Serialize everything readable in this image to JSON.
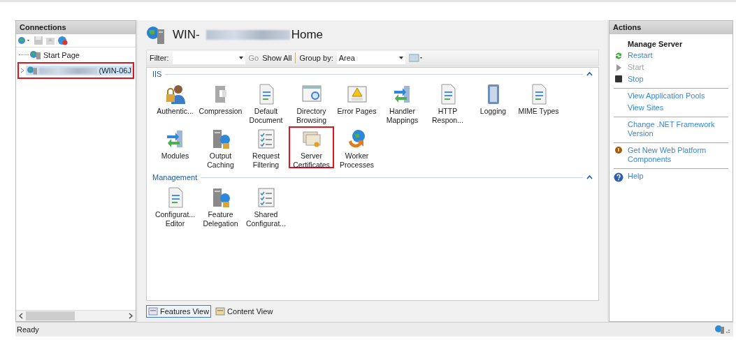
{
  "connections": {
    "title": "Connections",
    "tree": [
      {
        "label": "Start Page",
        "redacted": false,
        "selected": false,
        "highlighted": false
      },
      {
        "label": "(WIN-06J",
        "redacted": true,
        "selected": true,
        "highlighted": true
      }
    ]
  },
  "main": {
    "title_before": "WIN-",
    "title_after": "Home",
    "toolbar": {
      "filter_label": "Filter:",
      "go": "Go",
      "show_all": "Show All",
      "group_by_label": "Group by:",
      "group_by_value": "Area"
    },
    "groups": [
      {
        "name": "IIS",
        "expanded": true,
        "features": [
          {
            "label": "Authentic...",
            "highlighted": false
          },
          {
            "label": "Compression",
            "highlighted": false
          },
          {
            "label": "Default Document",
            "highlighted": false
          },
          {
            "label": "Directory Browsing",
            "highlighted": false
          },
          {
            "label": "Error Pages",
            "highlighted": false
          },
          {
            "label": "Handler Mappings",
            "highlighted": false
          },
          {
            "label": "HTTP Respon...",
            "highlighted": false
          },
          {
            "label": "Logging",
            "highlighted": false
          },
          {
            "label": "MIME Types",
            "highlighted": false
          },
          {
            "label": "Modules",
            "highlighted": false
          },
          {
            "label": "Output Caching",
            "highlighted": false
          },
          {
            "label": "Request Filtering",
            "highlighted": false
          },
          {
            "label": "Server Certificates",
            "highlighted": true
          },
          {
            "label": "Worker Processes",
            "highlighted": false
          }
        ]
      },
      {
        "name": "Management",
        "expanded": true,
        "features": [
          {
            "label": "Configurat... Editor",
            "highlighted": false
          },
          {
            "label": "Feature Delegation",
            "highlighted": false
          },
          {
            "label": "Shared Configurat...",
            "highlighted": false
          }
        ]
      }
    ],
    "view_tabs": [
      {
        "label": "Features View",
        "selected": true
      },
      {
        "label": "Content View",
        "selected": false
      }
    ]
  },
  "actions": {
    "title": "Actions",
    "heading": "Manage Server",
    "groups": [
      [
        {
          "label": "Restart",
          "disabled": false
        },
        {
          "label": "Start",
          "disabled": true
        },
        {
          "label": "Stop",
          "disabled": false
        }
      ],
      [
        {
          "label": "View Application Pools",
          "disabled": false
        },
        {
          "label": "View Sites",
          "disabled": false
        }
      ],
      [
        {
          "label": "Change .NET Framework Version",
          "disabled": false
        }
      ],
      [
        {
          "label": "Get New Web Platform Components",
          "disabled": false
        }
      ],
      [
        {
          "label": "Help",
          "disabled": false
        }
      ]
    ]
  },
  "status_bar": {
    "text": "Ready"
  }
}
